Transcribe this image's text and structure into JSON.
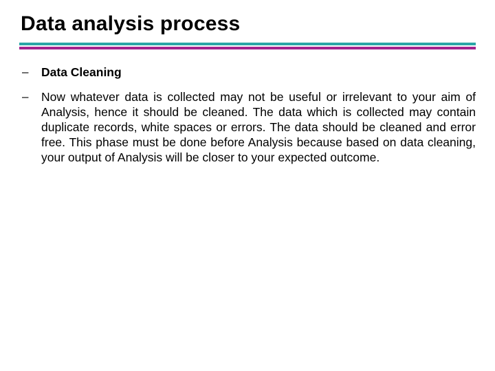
{
  "slide": {
    "title": "Data analysis process",
    "dash": "–",
    "items": [
      {
        "kind": "heading",
        "text": "Data Cleaning"
      },
      {
        "kind": "body",
        "text": "Now whatever data is collected may not be useful or irrelevant to your aim of Analysis, hence it should be cleaned. The data which is collected may contain duplicate records, white spaces or errors. The data should be cleaned and error free. This phase must be done before Analysis because based on data cleaning, your output of Analysis will be closer to your expected outcome."
      }
    ]
  },
  "colors": {
    "teal": "#2aa6a6",
    "magenta": "#a3238e"
  }
}
